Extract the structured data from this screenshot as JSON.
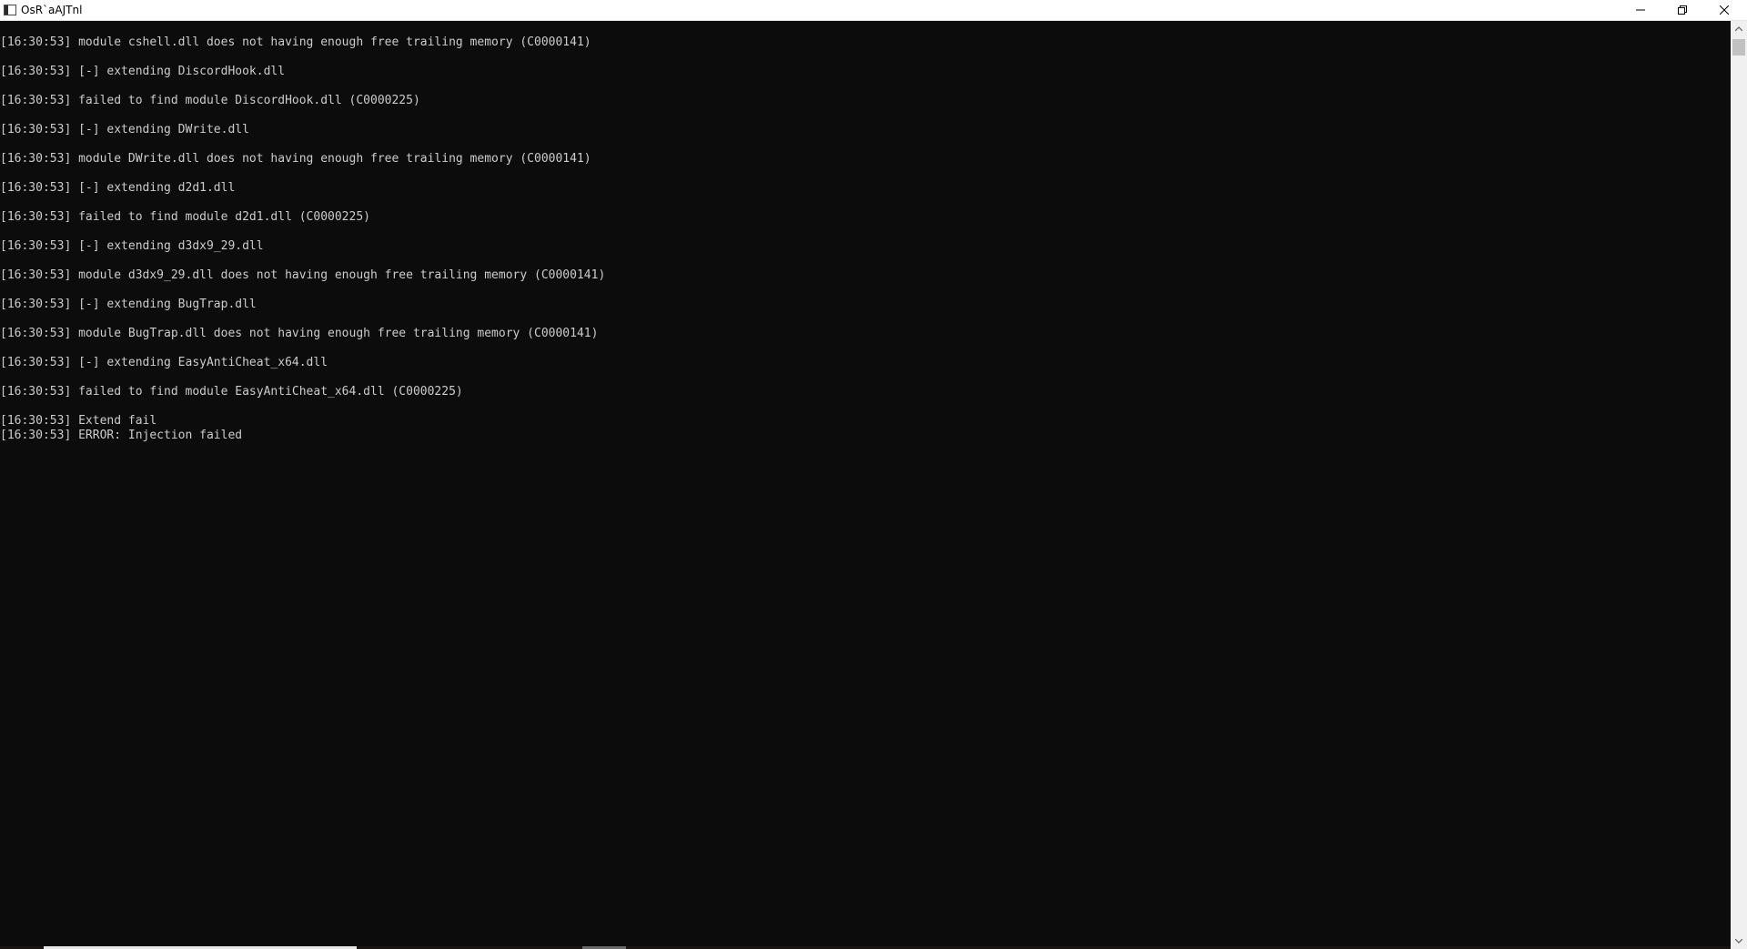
{
  "window": {
    "title": "OsR`aAJTnl",
    "colors": {
      "console_background": "#0c0c0c",
      "console_text": "#cccccc",
      "titlebar": "#ffffff"
    }
  },
  "titlebar_buttons": {
    "minimize_icon": "minimize-icon",
    "maximize_icon": "restore-icon",
    "close_icon": "close-icon"
  },
  "console": {
    "lines": [
      "[16:30:53] module cshell.dll does not having enough free trailing memory (C0000141)",
      "[16:30:53] [-] extending DiscordHook.dll",
      "[16:30:53] failed to find module DiscordHook.dll (C0000225)",
      "[16:30:53] [-] extending DWrite.dll",
      "[16:30:53] module DWrite.dll does not having enough free trailing memory (C0000141)",
      "[16:30:53] [-] extending d2d1.dll",
      "[16:30:53] failed to find module d2d1.dll (C0000225)",
      "[16:30:53] [-] extending d3dx9_29.dll",
      "[16:30:53] module d3dx9_29.dll does not having enough free trailing memory (C0000141)",
      "[16:30:53] [-] extending BugTrap.dll",
      "[16:30:53] module BugTrap.dll does not having enough free trailing memory (C0000141)",
      "[16:30:53] [-] extending EasyAntiCheat_x64.dll",
      "[16:30:53] failed to find module EasyAntiCheat_x64.dll (C0000225)",
      "[16:30:53] Extend fail",
      "[16:30:53] ERROR: Injection failed"
    ]
  }
}
